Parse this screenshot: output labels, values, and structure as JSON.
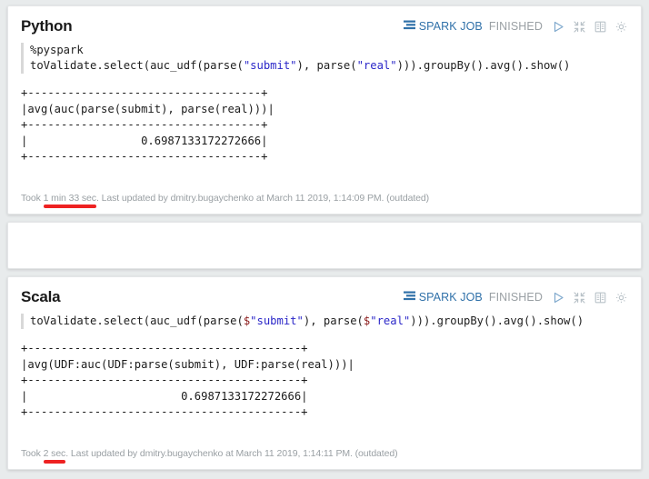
{
  "paragraphs": [
    {
      "id": "python",
      "title": "Python",
      "toolbar": {
        "spark_job_label": "SPARK JOB",
        "status": "FINISHED",
        "spark_icon": "spark-job-icon",
        "run_icon": "play-icon",
        "collapse_icon": "minimize-icon",
        "book_icon": "book-icon",
        "settings_icon": "gear-icon"
      },
      "code": {
        "line1": "%pyspark",
        "line2_a": "toValidate.select(auc_udf(parse(",
        "line2_str1": "\"submit\"",
        "line2_b": "), parse(",
        "line2_str2": "\"real\"",
        "line2_c": "))).groupBy().avg().show()"
      },
      "output": "+-------------------------------+\n|avg(auc(parse(submit), parse(real)))|\n+-------------------------------+\n|             0.6987133172272666|\n+-------------------------------+",
      "output_lines": [
        "+-----------------------------------+",
        "|avg(auc(parse(submit), parse(real)))|",
        "+-----------------------------------+",
        "|                 0.6987133172272666|",
        "+-----------------------------------+"
      ],
      "footer": {
        "took_prefix": "Took ",
        "took_duration": "1 min 33 sec",
        "rest": ". Last updated by dmitry.bugaychenko at March 11 2019, 1:14:09 PM. (outdated)"
      }
    },
    {
      "id": "scala",
      "title": "Scala",
      "toolbar": {
        "spark_job_label": "SPARK JOB",
        "status": "FINISHED",
        "spark_icon": "spark-job-icon",
        "run_icon": "play-icon",
        "collapse_icon": "minimize-icon",
        "book_icon": "book-icon",
        "settings_icon": "gear-icon"
      },
      "code": {
        "line1_a": "toValidate.select(auc_udf(parse(",
        "line1_dollar1": "$",
        "line1_str1": "\"submit\"",
        "line1_b": "), parse(",
        "line1_dollar2": "$",
        "line1_str2": "\"real\"",
        "line1_c": "))).groupBy().avg().show()"
      },
      "output_lines": [
        "+-----------------------------------------+",
        "|avg(UDF:auc(UDF:parse(submit), UDF:parse(real)))|",
        "+-----------------------------------------+",
        "|                       0.6987133172272666|",
        "+-----------------------------------------+"
      ],
      "footer": {
        "took_prefix": "Took ",
        "took_duration": "2 sec",
        "rest": ". Last updated by dmitry.bugaychenko at March 11 2019, 1:14:11 PM. (outdated)"
      }
    }
  ],
  "colors": {
    "background": "#e8ebec",
    "panel": "#ffffff",
    "accent_blue": "#3071a9",
    "status_gray": "#9aa0a4",
    "string_literal": "#2b27c8",
    "dollar_sign": "#8b1a1a",
    "highlight_red": "#ee2222"
  }
}
